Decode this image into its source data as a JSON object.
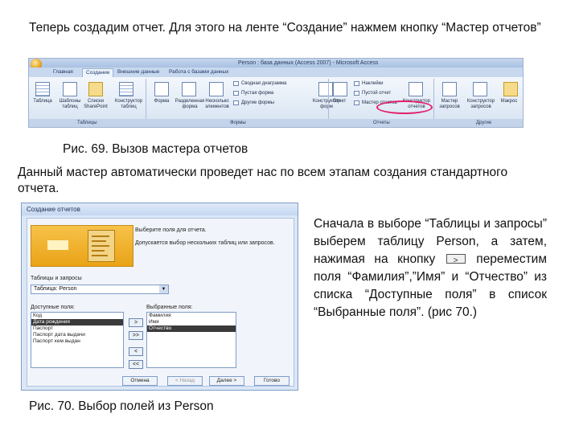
{
  "texts": {
    "intro": "Теперь создадим отчет. Для этого на ленте “Создание” нажмем кнопку “Мастер отчетов”",
    "caption69": "Рис. 69. Вызов мастера отчетов",
    "para2": "Данный мастер автоматически проведет нас по всем этапам создания стандартного отчета.",
    "para3_a": "Сначала в выборе “Таблицы и запросы” выберем таблицу Person, а затем, нажимая на кнопку",
    "para3_b": "переместим поля “Фамилия”,”Имя” и “Отчество” из списка “Доступные поля” в список “Выбранные поля”. (рис 70.)",
    "caption70": "Рис. 70. Выбор полей из Person"
  },
  "ribbon": {
    "window_title": "Person : база данных (Access 2007) - Microsoft Access",
    "tabs": [
      "Главная",
      "Создание",
      "Внешние данные",
      "Работа с базами данных"
    ],
    "buttons": {
      "table": "Таблица",
      "templates": "Шаблоны таблиц",
      "lists": "Списки SharePoint",
      "table_designer": "Конструктор таблиц",
      "form": "Форма",
      "split_form": "Разделенная форма",
      "multi_items": "Несколько элементов",
      "pivot_chart": "Сводная диаграмма",
      "blank_form": "Пустая форма",
      "more_forms": "Другие формы",
      "form_designer": "Конструктор форм",
      "report": "Отчет",
      "labels": "Наклейки",
      "blank_report": "Пустой отчет",
      "report_wizard": "Мастер отчетов",
      "report_designer": "Конструктор отчетов",
      "query_wizard": "Мастер запросов",
      "query_designer": "Конструктор запросов",
      "macro": "Макрос"
    },
    "groups": [
      "Таблицы",
      "Формы",
      "Отчеты",
      "Другие"
    ]
  },
  "wizard": {
    "title": "Создание отчетов",
    "prompt1": "Выберите поля для отчета.",
    "prompt2": "Допускается выбор нескольких таблиц или запросов.",
    "tables_label": "Таблицы и запросы",
    "selected_table": "Таблица: Person",
    "available_label": "Доступные поля:",
    "selected_label": "Выбранные поля:",
    "available_fields": [
      "Код",
      "Дата рождения",
      "Паспорт",
      "Паспорт дата выдачи",
      "Паспорт кем выдан"
    ],
    "available_selected_index": 1,
    "selected_fields": [
      "Фамилия",
      "Имя",
      "Отчество"
    ],
    "selected_selected_index": 2,
    "move_buttons": [
      ">",
      ">>",
      "<",
      "<<"
    ],
    "footer_buttons": {
      "cancel": "Отмена",
      "back": "< Назад",
      "next": "Далее >",
      "finish": "Готово"
    }
  }
}
